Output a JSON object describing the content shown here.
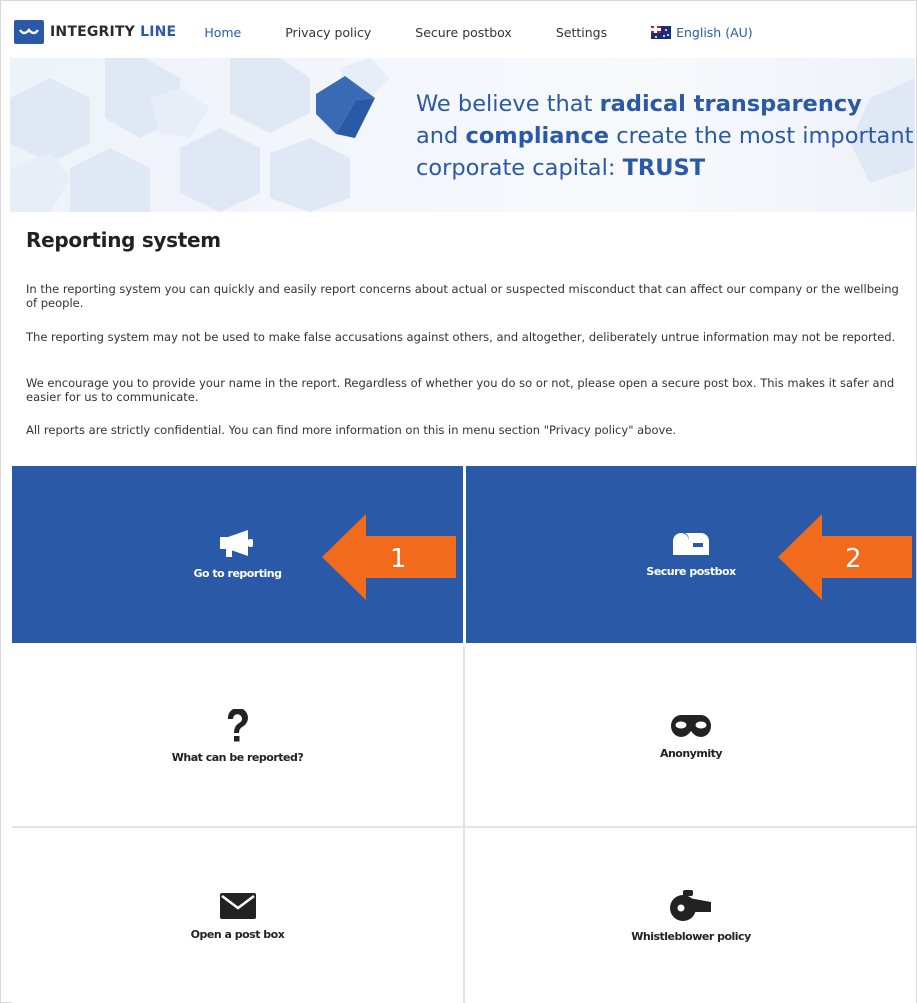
{
  "header": {
    "logo_text_a": "INTEGRITY",
    "logo_text_b": "LINE",
    "nav": [
      {
        "label": "Home"
      },
      {
        "label": "Privacy policy"
      },
      {
        "label": "Secure postbox"
      },
      {
        "label": "Settings"
      }
    ],
    "language": "English (AU)"
  },
  "banner": {
    "line1_a": "We believe that ",
    "line1_b": "radical transparency",
    "line2_a": "and ",
    "line2_b": "compliance",
    "line2_c": " create the most important",
    "line3_a": "corporate capital: ",
    "line3_b": "TRUST"
  },
  "main": {
    "title": "Reporting system",
    "paragraphs": [
      "In the reporting system you can quickly and easily report concerns about actual or suspected misconduct that can affect our company or the wellbeing of people.",
      "The reporting system may not be used to make false accusations against others, and altogether, deliberately untrue information may not be reported.",
      "We encourage you to provide your name in the report. Regardless of whether you do so or not, please open a secure post box. This makes it safer and easier for us to communicate.",
      "All reports are strictly confidential. You can find more information on this in menu section \"Privacy policy\" above."
    ]
  },
  "tiles": [
    {
      "label": "Go to reporting",
      "icon": "megaphone-icon"
    },
    {
      "label": "Secure postbox",
      "icon": "mailbox-icon"
    },
    {
      "label": "What can be reported?",
      "icon": "question-icon"
    },
    {
      "label": "Anonymity",
      "icon": "mask-icon"
    },
    {
      "label": "Open a post box",
      "icon": "envelope-icon"
    },
    {
      "label": "Whistleblower policy",
      "icon": "whistle-icon"
    }
  ],
  "annotations": [
    {
      "number": "1"
    },
    {
      "number": "2"
    }
  ],
  "colors": {
    "brand_blue": "#2a5aa7",
    "arrow_orange": "#f26b1d"
  }
}
